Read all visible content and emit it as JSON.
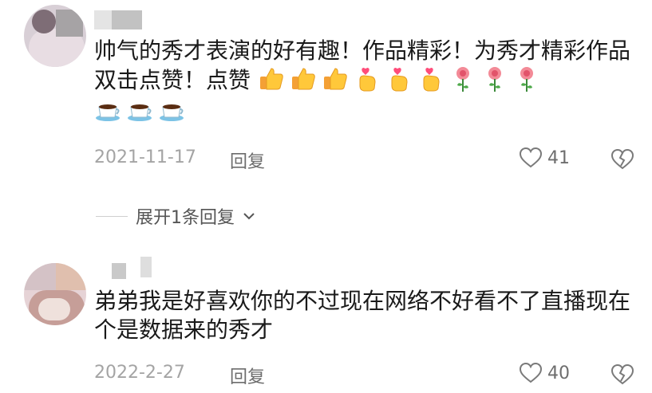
{
  "comments": [
    {
      "text": "帅气的秀才表演的好有趣！作品精彩！为秀才精彩作品双击点赞！点赞",
      "date": "2021-11-17",
      "reply_label": "回复",
      "likes": "41"
    },
    {
      "text": "弟弟我是好喜欢你的不过现在网络不好看不了直播现在个是数据来的秀才",
      "date": "2022-2-27",
      "reply_label": "回复",
      "likes": "40"
    }
  ],
  "expand_replies": "展开1条回复",
  "emojis": [
    "thumbs-up",
    "thumbs-up",
    "thumbs-up",
    "finger-heart",
    "finger-heart",
    "finger-heart",
    "rose",
    "rose",
    "rose",
    "coffee",
    "coffee",
    "coffee"
  ],
  "colors": {
    "meta": "#a4a4a4",
    "text": "#1a1a1a",
    "icon": "#7a7a7a"
  }
}
